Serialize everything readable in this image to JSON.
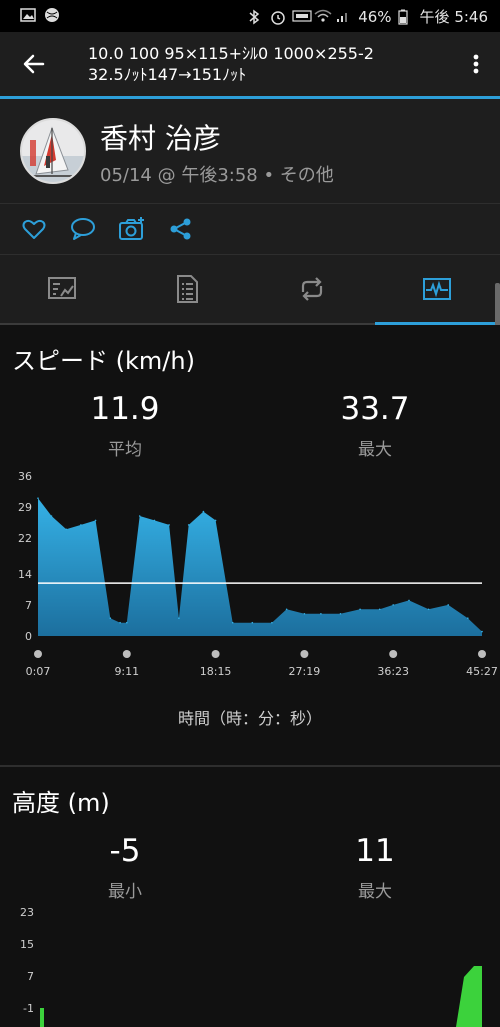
{
  "status_bar": {
    "battery": "46%",
    "time": "午後 5:46"
  },
  "app_bar": {
    "title_line1": "10.0 100 95×115+ｼﾙ0 1000×255-2",
    "title_line2": "32.5ﾉｯﾄ147→151ﾉｯﾄ"
  },
  "profile": {
    "name": "香村 治彦",
    "meta": "05/14 @ 午後3:58 • その他"
  },
  "speed": {
    "title": "スピード (km/h)",
    "avg_value": "11.9",
    "avg_label": "平均",
    "max_value": "33.7",
    "max_label": "最大",
    "x_axis_title": "時間（時：分：秒）"
  },
  "altitude": {
    "title": "高度 (m)",
    "min_value": "-5",
    "min_label": "最小",
    "max_value": "11",
    "max_label": "最大"
  },
  "colors": {
    "accent": "#2d9fd9",
    "speed_fill_top": "#35b1e6",
    "speed_fill_bottom": "#1c6f9e",
    "altitude_fill": "#3cd23c",
    "average_line": "#ffffff"
  },
  "chart_data": [
    {
      "type": "area",
      "title": "スピード (km/h)",
      "xlabel": "時間（時：分：秒）",
      "ylabel": "",
      "y_ticks": [
        "36",
        "29",
        "22",
        "14",
        "7",
        "0"
      ],
      "x_ticks": [
        "0:07",
        "9:11",
        "18:15",
        "27:19",
        "36:23",
        "45:27"
      ],
      "ylim": [
        0,
        36
      ],
      "average": 11.9,
      "x": [
        "0:07",
        "1:30",
        "3:00",
        "4:30",
        "6:00",
        "7:30",
        "8:30",
        "9:11",
        "10:30",
        "12:00",
        "13:30",
        "14:30",
        "15:30",
        "17:00",
        "18:15",
        "20:00",
        "22:00",
        "24:00",
        "25:30",
        "27:19",
        "29:00",
        "31:00",
        "33:00",
        "35:00",
        "36:23",
        "38:00",
        "40:00",
        "42:00",
        "44:00",
        "45:27"
      ],
      "values": [
        31,
        27,
        24,
        25,
        26,
        4,
        3,
        3,
        27,
        26,
        25,
        4,
        25,
        28,
        26,
        3,
        3,
        3,
        6,
        5,
        5,
        5,
        6,
        6,
        7,
        8,
        6,
        7,
        4,
        1
      ]
    },
    {
      "type": "area",
      "title": "高度 (m)",
      "xlabel": "",
      "ylabel": "",
      "y_ticks": [
        "23",
        "15",
        "7",
        "-1"
      ],
      "ylim": [
        -1,
        23
      ]
    }
  ]
}
